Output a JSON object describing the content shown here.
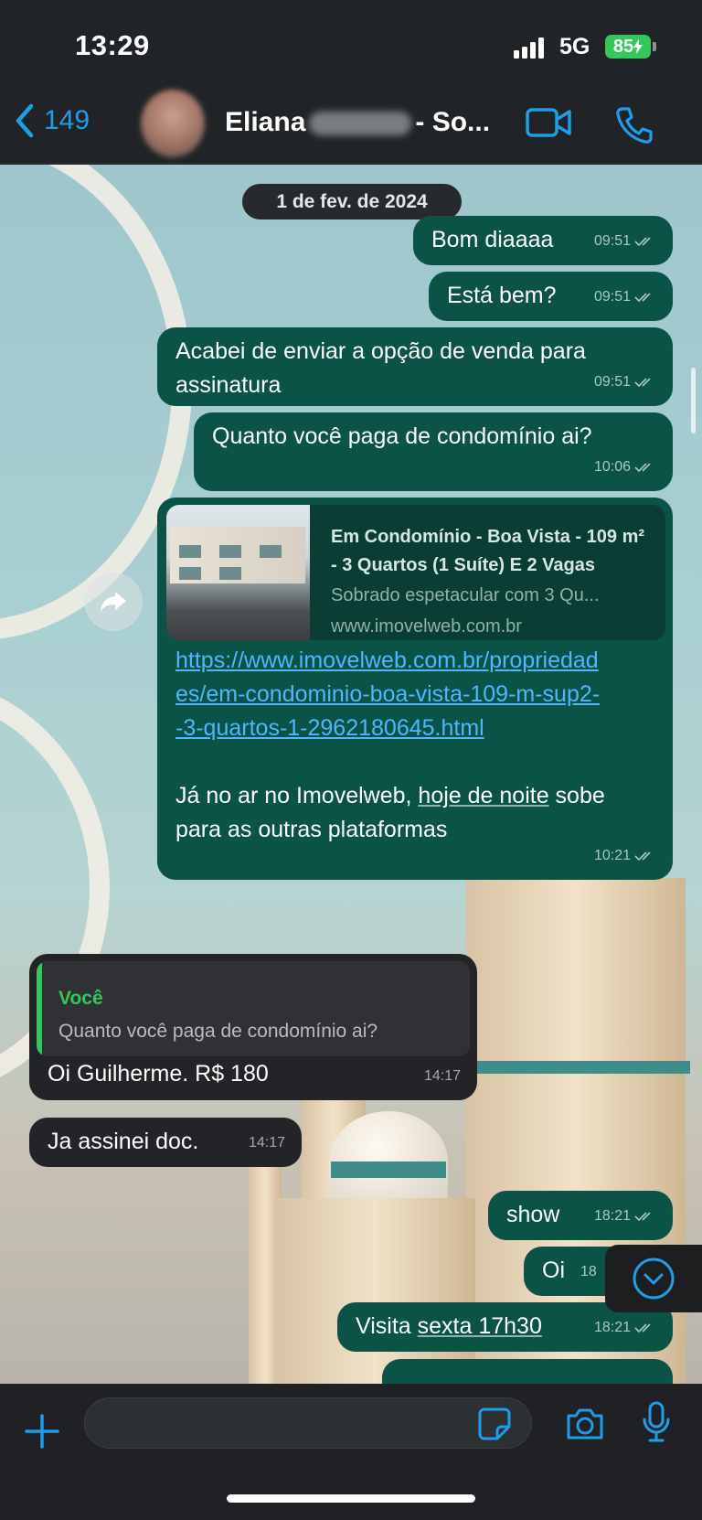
{
  "status_bar": {
    "time": "13:29",
    "network": "5G",
    "battery": "85"
  },
  "header": {
    "back_count": "149",
    "contact_name_start": "Eliana",
    "contact_name_end": "- So..."
  },
  "chat": {
    "date": "1 de fev. de 2024",
    "messages": [
      {
        "text": "Bom diaaaa",
        "time": "09:51"
      },
      {
        "text": "Está bem?",
        "time": "09:51"
      },
      {
        "text": "Acabei de enviar a opção de venda para assinatura",
        "time": "09:51"
      },
      {
        "text": "Quanto você paga de condomínio ai?",
        "time": "10:06"
      },
      {
        "link_title": "Em Condomínio - Boa Vista - 109 m² - 3 Quartos (1 Suíte) E 2 Vagas",
        "link_desc": "Sobrado espetacular com 3 Qu...",
        "link_domain": "www.imovelweb.com.br",
        "url": "https://www.imovelweb.com.br/propriedades/em-condominio-boa-vista-109-m-sup2--3-quartos-1-2962180645.html",
        "text_a": "Já no ar no Imovelweb, ",
        "text_b": "hoje de noite",
        "text_c": " sobe para as outras plataformas",
        "time": "10:21"
      },
      {
        "quote_author": "Você",
        "quote_text": "Quanto você paga de condomínio ai?",
        "text": "Oi Guilherme. R$ 180",
        "time": "14:17"
      },
      {
        "text": "Ja assinei doc.",
        "time": "14:17"
      },
      {
        "text": "show",
        "time": "18:21"
      },
      {
        "text": "Oi",
        "time": "18"
      },
      {
        "text_a": "Visita ",
        "text_b": "sexta 17h30",
        "time": "18:21"
      }
    ]
  },
  "input": {
    "placeholder": "",
    "value": ""
  },
  "icons": {
    "back": "chevron-left-icon",
    "video": "video-camera-icon",
    "call": "phone-icon",
    "forward": "forward-arrow-icon",
    "scroll_down": "chevron-down-circle-icon",
    "plus": "plus-icon",
    "sticker": "sticker-icon",
    "camera": "camera-icon",
    "mic": "microphone-icon"
  },
  "colors": {
    "accent": "#1e9de9",
    "outgoing_bubble": "#0b5346",
    "incoming_bubble": "#222427",
    "battery": "#35c759",
    "link": "#4fb6ff"
  }
}
